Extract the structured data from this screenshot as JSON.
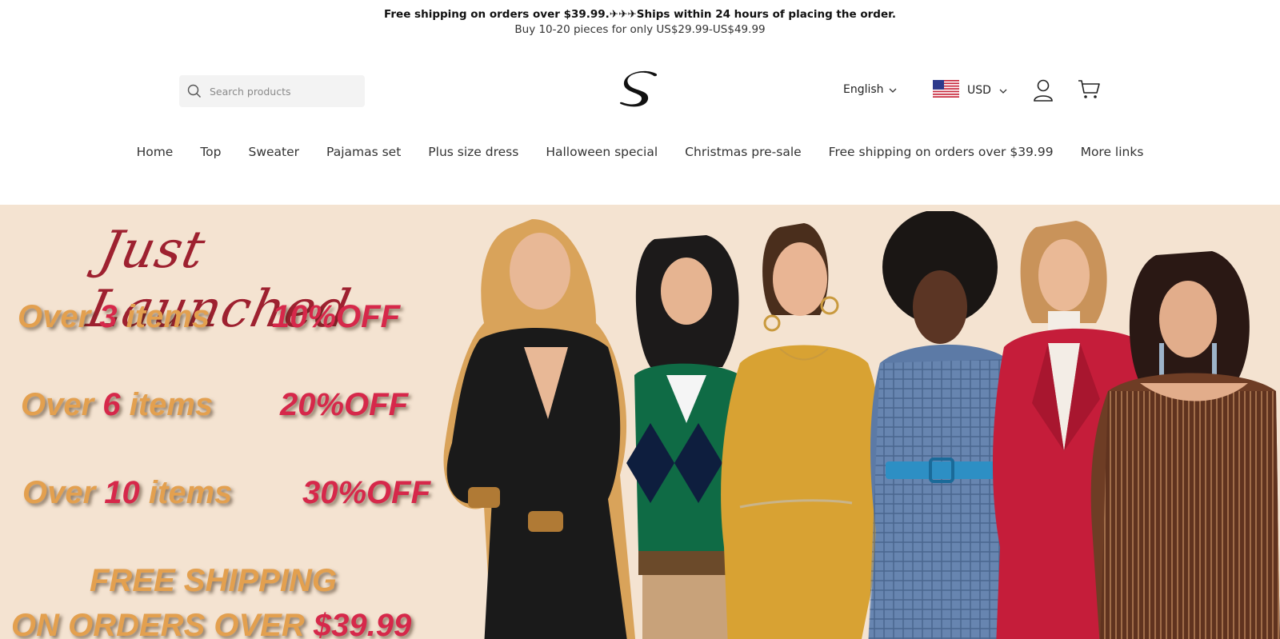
{
  "announcement": {
    "line1": "Free shipping on orders over $39.99.✈✈✈Ships within 24 hours of placing the order.",
    "line2": "Buy 10-20 pieces for only US$29.99-US$49.99"
  },
  "header": {
    "search_placeholder": "Search products",
    "logo_text": "S",
    "language": "English",
    "currency": "USD",
    "icons": [
      "search-icon",
      "chevron-down-icon",
      "us-flag-icon",
      "account-icon",
      "cart-icon"
    ]
  },
  "nav": {
    "items": [
      "Home",
      "Top",
      "Sweater",
      "Pajamas set",
      "Plus size dress",
      "Halloween special",
      "Christmas pre-sale",
      "Free shipping on orders over $39.99",
      "More links"
    ]
  },
  "hero": {
    "script_title": "Just Launched",
    "promos": [
      {
        "prefix": "Over ",
        "num": "3",
        "suffix": " items",
        "discount": "10%OFF"
      },
      {
        "prefix": "Over ",
        "num": "6",
        "suffix": " items",
        "discount": "20%OFF"
      },
      {
        "prefix": "Over ",
        "num": "10",
        "suffix": " items",
        "discount": "30%OFF"
      }
    ],
    "free_line1": "FREE SHIPPING",
    "free_line2_prefix": "ON ORDERS OVER ",
    "free_line2_amount": "$39.99"
  },
  "colors": {
    "hero_bg": "#f4e3d1",
    "script_red": "#9e2130",
    "promo_orange": "#e3a04f",
    "promo_red": "#d6284a"
  }
}
